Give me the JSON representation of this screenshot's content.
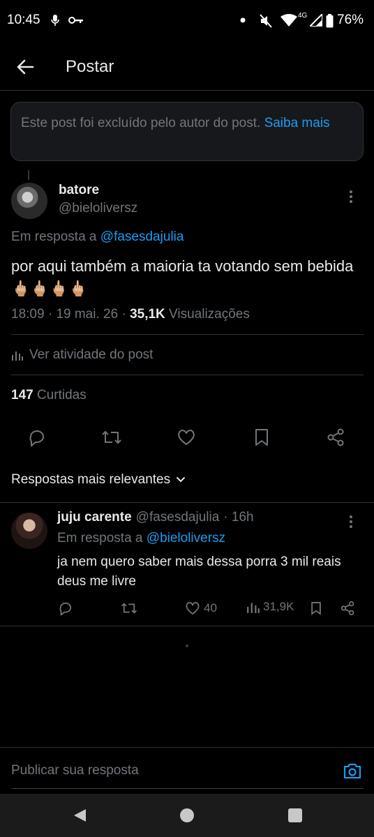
{
  "status_bar": {
    "time": "10:45",
    "network": "4G",
    "battery": "76%"
  },
  "header": {
    "title": "Postar"
  },
  "deleted_notice": {
    "text": "Este post foi excluído pelo autor do post.",
    "link": "Saiba mais"
  },
  "post": {
    "author_name": "batore",
    "author_handle": "@bieloliversz",
    "reply_to_prefix": "Em resposta a",
    "reply_to_handle": "@fasesdajulia",
    "text": "por aqui também a maioria ta votando sem bebida🖕🏼🖕🏼🖕🏼🖕🏼",
    "time": "18:09",
    "date": "19 mai. 26",
    "views_count": "35,1K",
    "views_label": "Visualizações",
    "activity_label": "Ver atividade do post",
    "likes_count": "147",
    "likes_label": "Curtidas"
  },
  "replies_sort": {
    "label": "Respostas mais relevantes"
  },
  "reply": {
    "author_name": "juju carente",
    "author_handle": "@fasesdajulia",
    "age": "· 16h",
    "reply_to_prefix": "Em resposta a",
    "reply_to_handle": "@bieloliversz",
    "text": "ja nem quero saber mais dessa porra 3 mil reais deus me livre",
    "likes": "40",
    "views": "31,9K"
  },
  "compose": {
    "placeholder": "Publicar sua resposta"
  },
  "colors": {
    "background": "#000000",
    "accent": "#1d9bf0",
    "muted": "#71767b",
    "text": "#e7e9ea",
    "divider": "#2f3336"
  }
}
